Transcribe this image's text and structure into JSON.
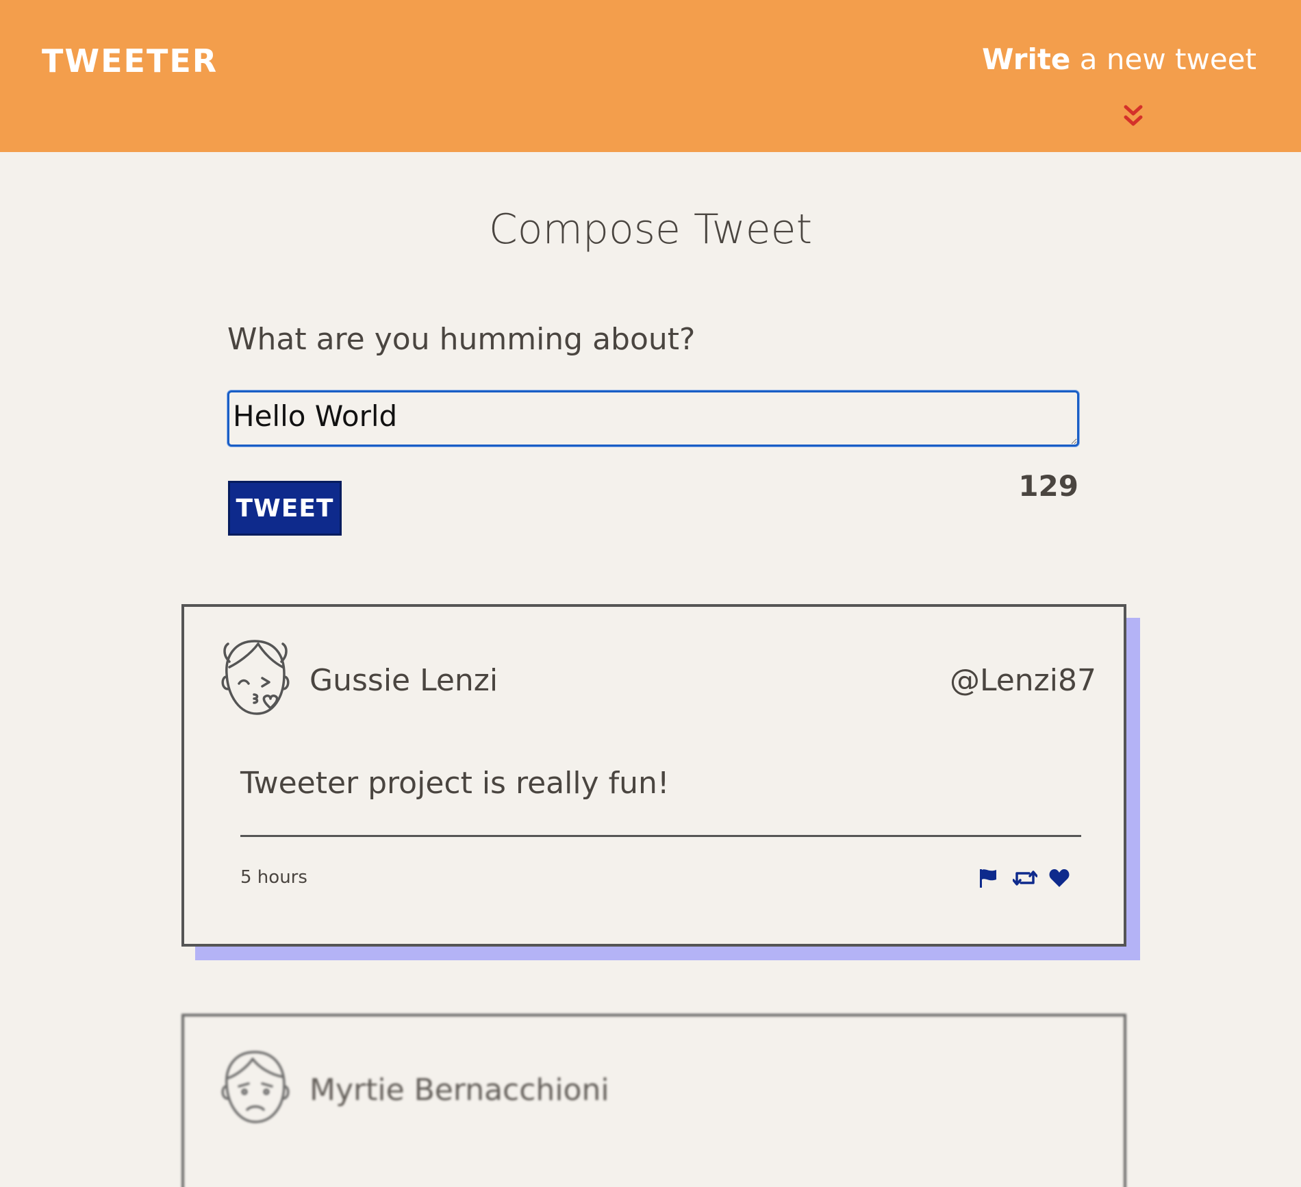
{
  "nav": {
    "brand": "TWEETER",
    "write_bold": "Write",
    "write_rest": " a new tweet",
    "toggle_icon": "double-chevron-down-icon",
    "background_color": "#f39e4c",
    "chevron_color": "#d4312a"
  },
  "compose": {
    "title": "Compose Tweet",
    "prompt": "What are you humming about?",
    "input_value": "Hello World",
    "button_label": "TWEET",
    "counter": "129",
    "button_color": "#0e2a8c"
  },
  "tweets": [
    {
      "name": "Gussie Lenzi",
      "handle": "@Lenzi87",
      "content": "Tweeter project is really fun!",
      "time": "5 hours",
      "avatar_icon": "kissing-face-avatar-icon",
      "actions": [
        "flag-icon",
        "retweet-icon",
        "heart-icon"
      ],
      "shadow_color": "#b4b3f6"
    },
    {
      "name": "Myrtie Bernacchioni",
      "avatar_icon": "sad-face-avatar-icon"
    }
  ]
}
